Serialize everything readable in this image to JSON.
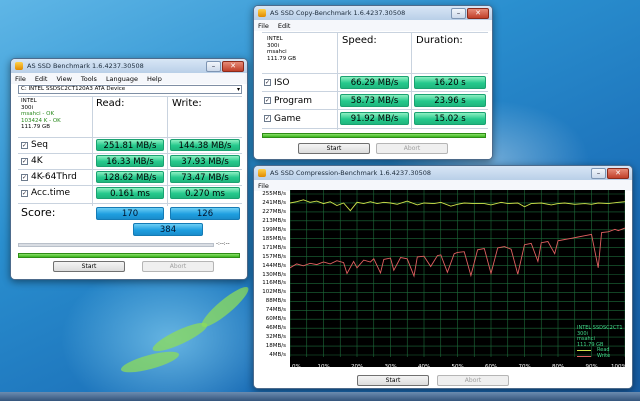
{
  "desktop": {},
  "bench": {
    "title": "AS SSD Benchmark 1.6.4237.30508",
    "menu": [
      "File",
      "Edit",
      "View",
      "Tools",
      "Language",
      "Help"
    ],
    "drive_select": "C: INTEL SSDSC2CT120A3 ATA Device",
    "drive_info": {
      "model": "INTEL",
      "fw": "300i",
      "driver": "msahci - OK",
      "align": "103424 K - OK",
      "size": "111.79 GB"
    },
    "headers": {
      "read": "Read:",
      "write": "Write:"
    },
    "rows": [
      {
        "label": "Seq",
        "read": "251.81 MB/s",
        "write": "144.38 MB/s"
      },
      {
        "label": "4K",
        "read": "16.33 MB/s",
        "write": "37.93 MB/s"
      },
      {
        "label": "4K-64Thrd",
        "read": "128.62 MB/s",
        "write": "73.47 MB/s"
      },
      {
        "label": "Acc.time",
        "read": "0.161 ms",
        "write": "0.270 ms"
      }
    ],
    "score_label": "Score:",
    "score_read": "170",
    "score_write": "126",
    "score_total": "384",
    "progress_time": "-:--:--",
    "start": "Start",
    "abort": "Abort"
  },
  "copy": {
    "title": "AS SSD Copy-Benchmark 1.6.4237.30508",
    "menu": [
      "File",
      "Edit"
    ],
    "drive_info": {
      "model": "INTEL",
      "fw": "300i",
      "driver": "msahci",
      "size": "111.79 GB"
    },
    "headers": {
      "speed": "Speed:",
      "duration": "Duration:"
    },
    "rows": [
      {
        "label": "ISO",
        "speed": "66.29 MB/s",
        "duration": "16.20 s"
      },
      {
        "label": "Program",
        "speed": "58.73 MB/s",
        "duration": "23.96 s"
      },
      {
        "label": "Game",
        "speed": "91.92 MB/s",
        "duration": "15.02 s"
      }
    ],
    "start": "Start",
    "abort": "Abort"
  },
  "compression": {
    "title": "AS SSD Compression-Benchmark 1.6.4237.30508",
    "menu": [
      "File"
    ],
    "legend": {
      "device": "INTEL SSDSC2CT1",
      "fw": "300i",
      "driver": "msahci",
      "size": "111.79 GB",
      "read": "Read",
      "write": "Write"
    },
    "start": "Start",
    "abort": "Abort"
  },
  "chart_data": {
    "type": "line",
    "xlabel": "",
    "ylabel": "",
    "x_tick_labels": [
      "0%",
      "10%",
      "20%",
      "30%",
      "40%",
      "50%",
      "60%",
      "70%",
      "80%",
      "90%",
      "100%"
    ],
    "y_tick_labels": [
      "255MB/s",
      "241MB/s",
      "227MB/s",
      "213MB/s",
      "199MB/s",
      "185MB/s",
      "171MB/s",
      "157MB/s",
      "144MB/s",
      "130MB/s",
      "116MB/s",
      "102MB/s",
      "88MB/s",
      "74MB/s",
      "60MB/s",
      "46MB/s",
      "32MB/s",
      "18MB/s",
      "4MB/s"
    ],
    "ylim": [
      4,
      255
    ],
    "grid": true,
    "series": [
      {
        "name": "Read",
        "color": "#cfe24a",
        "x": [
          0,
          2,
          4,
          6,
          8,
          10,
          12,
          14,
          16,
          18,
          20,
          22,
          24,
          26,
          28,
          30,
          32,
          35,
          38,
          40,
          43,
          45,
          48,
          50,
          52,
          55,
          58,
          60,
          63,
          65,
          68,
          70,
          72,
          75,
          78,
          80,
          82,
          85,
          88,
          90,
          92,
          95,
          98,
          100
        ],
        "values": [
          241,
          243,
          246,
          242,
          244,
          240,
          243,
          237,
          241,
          229,
          242,
          240,
          243,
          240,
          242,
          241,
          239,
          244,
          238,
          241,
          240,
          242,
          236,
          239,
          241,
          240,
          240,
          238,
          242,
          240,
          241,
          235,
          240,
          241,
          238,
          240,
          241,
          239,
          240,
          239,
          241,
          240,
          242,
          243
        ]
      },
      {
        "name": "Write",
        "color": "#e06060",
        "x": [
          0,
          2,
          4,
          6,
          8,
          10,
          12,
          14,
          16,
          17,
          19,
          20,
          22,
          24,
          25,
          27,
          28,
          30,
          31,
          33,
          35,
          37,
          38,
          40,
          42,
          44,
          45,
          47,
          49,
          50,
          52,
          54,
          56,
          58,
          60,
          62,
          64,
          66,
          68,
          70,
          72,
          74,
          75,
          77,
          79,
          80,
          82,
          84,
          86,
          88,
          90,
          92,
          93,
          95,
          97,
          98,
          100
        ],
        "values": [
          140,
          146,
          143,
          147,
          145,
          149,
          146,
          151,
          148,
          131,
          150,
          140,
          152,
          149,
          154,
          132,
          153,
          155,
          136,
          156,
          154,
          127,
          157,
          158,
          142,
          159,
          160,
          133,
          162,
          164,
          165,
          128,
          168,
          170,
          131,
          171,
          173,
          169,
          130,
          176,
          178,
          150,
          179,
          181,
          162,
          182,
          184,
          186,
          188,
          190,
          192,
          140,
          195,
          196,
          200,
          198,
          202
        ]
      }
    ]
  }
}
